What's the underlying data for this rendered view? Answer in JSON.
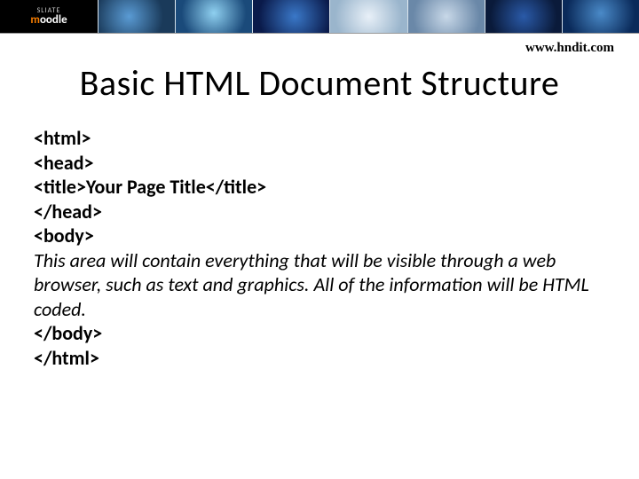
{
  "banner": {
    "logo_top": "SLIATE",
    "logo_bottom": "moodle"
  },
  "header": {
    "url": "www.hndit.com"
  },
  "slide": {
    "title": "Basic HTML Document Structure",
    "lines": {
      "l1": "<html>",
      "l2": "<head>",
      "l3": "<title>Your Page Title</title>",
      "l4": "</head>",
      "l5": "<body>",
      "l6": "This area will contain everything that will be visible through a web browser, such as text and graphics. All of the information will be HTML coded.",
      "l7": "</body>",
      "l8": "</html>"
    }
  }
}
